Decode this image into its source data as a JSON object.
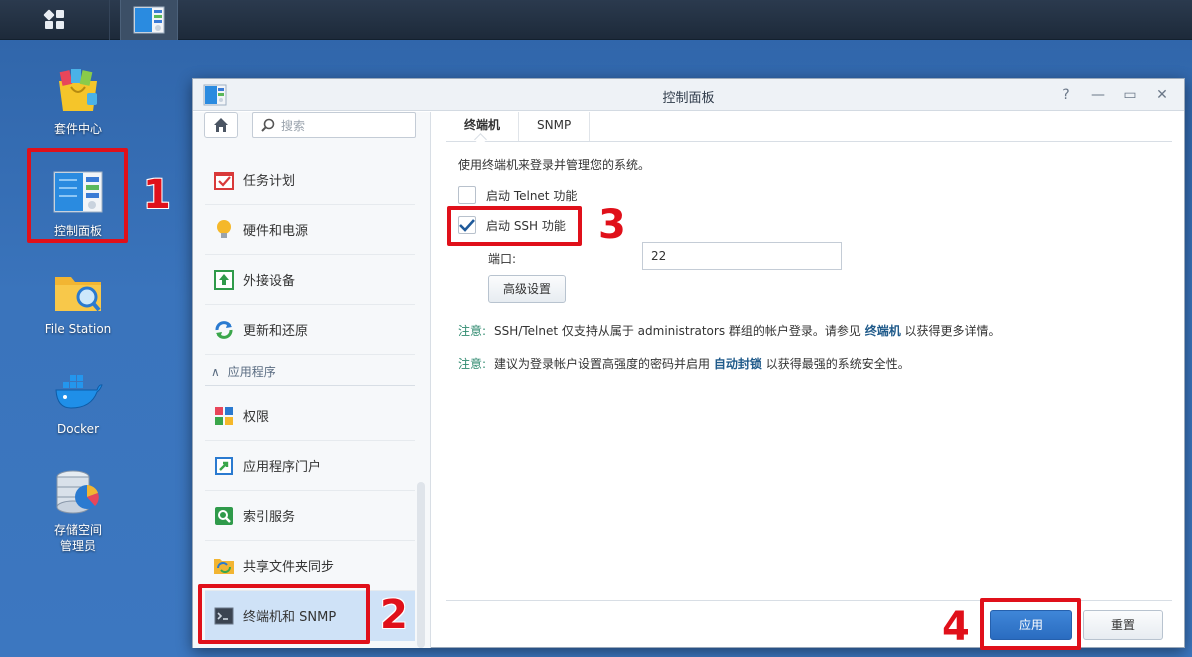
{
  "desktop": {
    "icons": [
      {
        "label": "套件中心"
      },
      {
        "label": "控制面板"
      },
      {
        "label": "File Station"
      },
      {
        "label": "Docker"
      },
      {
        "label": "存储空间管理员"
      }
    ]
  },
  "window": {
    "title": "控制面板",
    "controls": {
      "help": "?",
      "minimize": "—",
      "maximize": "▭",
      "close": "✕"
    }
  },
  "sidebar": {
    "search_placeholder": "搜索",
    "items_top": [
      {
        "label": "任务计划",
        "icon": "task-scheduler-icon"
      },
      {
        "label": "硬件和电源",
        "icon": "lightbulb-icon"
      },
      {
        "label": "外接设备",
        "icon": "external-device-icon"
      },
      {
        "label": "更新和还原",
        "icon": "update-restore-icon"
      }
    ],
    "section_label": "应用程序",
    "items_apps": [
      {
        "label": "权限",
        "icon": "privileges-icon"
      },
      {
        "label": "应用程序门户",
        "icon": "app-portal-icon"
      },
      {
        "label": "索引服务",
        "icon": "indexing-icon"
      },
      {
        "label": "共享文件夹同步",
        "icon": "shared-folder-sync-icon"
      },
      {
        "label": "终端机和 SNMP",
        "icon": "terminal-icon"
      }
    ]
  },
  "content": {
    "tabs": [
      "终端机",
      "SNMP"
    ],
    "description": "使用终端机来登录并管理您的系统。",
    "telnet_label": "启动 Telnet 功能",
    "ssh_label": "启动 SSH 功能",
    "port_label": "端口:",
    "port_value": "22",
    "advanced_button": "高级设置",
    "note1": {
      "label": "注意:",
      "text": "SSH/Telnet 仅支持从属于 administrators 群组的帐户登录。请参见 ",
      "link": "终端机",
      "tail": " 以获得更多详情。"
    },
    "note2": {
      "label": "注意:",
      "text": "建议为登录帐户设置高强度的密码并启用 ",
      "link": "自动封锁",
      "tail": " 以获得最强的系统安全性。"
    },
    "apply_button": "应用",
    "reset_button": "重置"
  },
  "annotations": [
    "1",
    "2",
    "3",
    "4"
  ],
  "colors": {
    "accent": "#2a6cc0",
    "marker": "#e0101a",
    "active_nav": "#cfe2f7"
  }
}
